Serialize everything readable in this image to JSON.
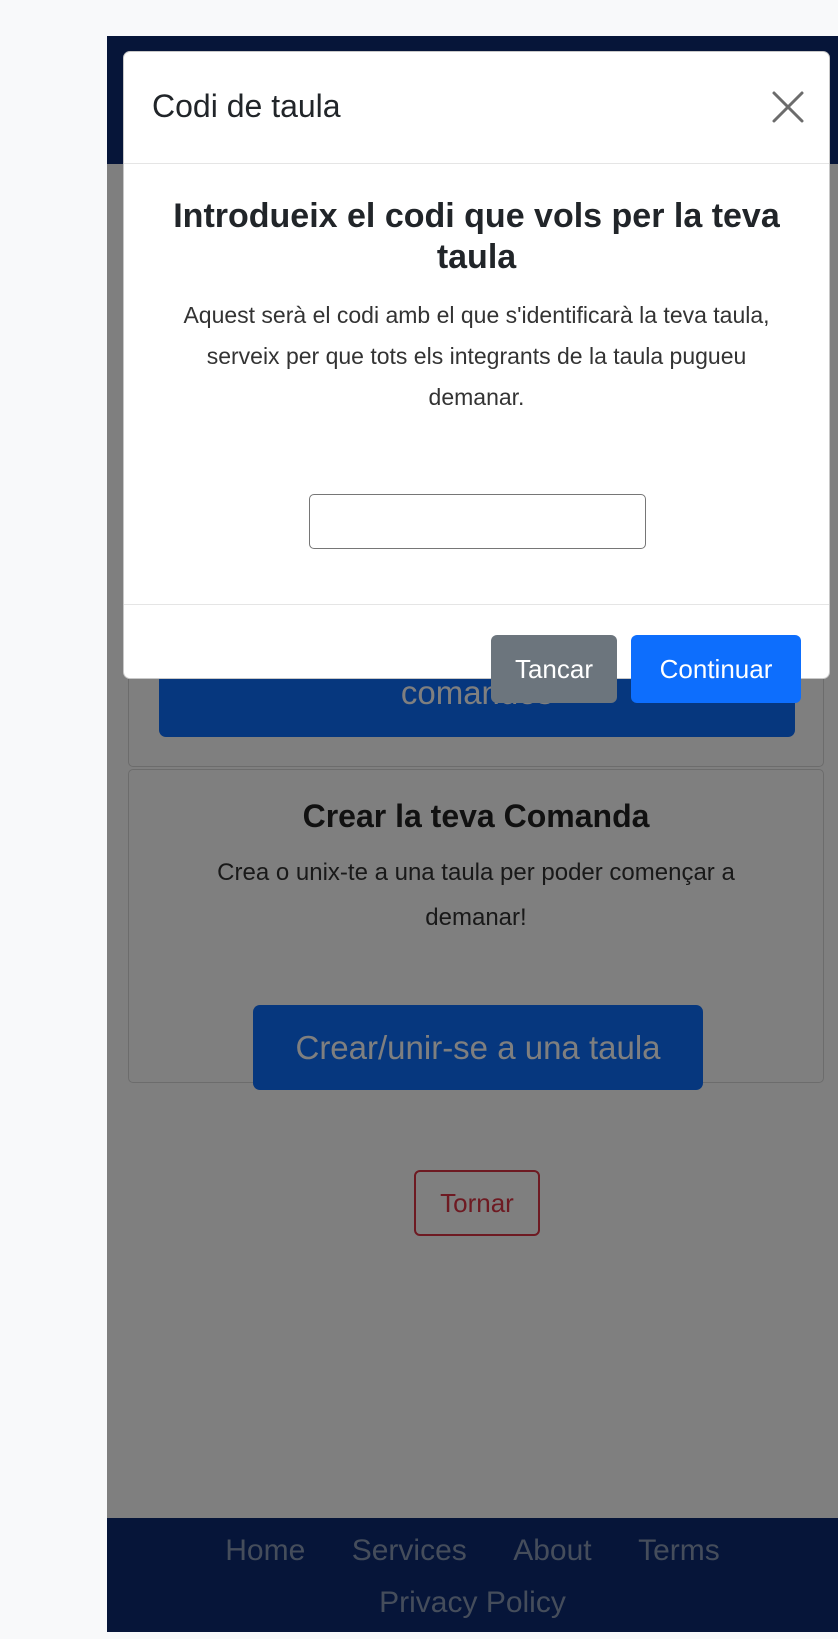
{
  "modal": {
    "title": "Codi de taula",
    "heading": "Introdueix el codi que vols per la teva taula",
    "description": "Aquest serà el codi amb el que s'identificarà la teva taula, serveix per que tots els integrants de la taula pugueu demanar.",
    "input_value": "",
    "close_label": "Tancar",
    "continue_label": "Continuar"
  },
  "cards": {
    "old_orders_button": "comandes",
    "create_title": "Crear la teva Comanda",
    "create_text": "Crea o unix-te a una taula per poder començar a demanar!",
    "create_button": "Crear/unir-se a una taula"
  },
  "back_button": "Tornar",
  "footer": {
    "links": [
      "Home",
      "Services",
      "About",
      "Terms",
      "Privacy Policy"
    ]
  },
  "colors": {
    "navbar": "#0c2a73",
    "primary": "#0d6efd",
    "secondary": "#6c757d",
    "danger": "#dc3545"
  }
}
